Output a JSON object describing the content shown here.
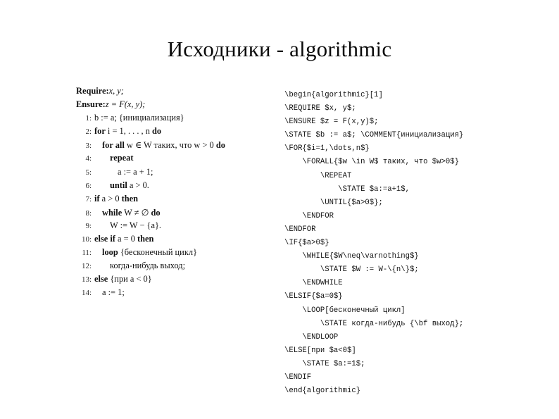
{
  "slide": {
    "title": "Исходники - algorithmic"
  },
  "algorithm_render": {
    "header_lines": [
      {
        "keyword": "Require:",
        "rest": " x, y;"
      },
      {
        "keyword": "Ensure:",
        "rest": " z = F(x, y);"
      }
    ],
    "lines": [
      {
        "num": "1:",
        "indent": 0,
        "text": "b := a;  {инициализация}"
      },
      {
        "num": "2:",
        "indent": 0,
        "text": "for i = 1, . . . , n do"
      },
      {
        "num": "3:",
        "indent": 1,
        "text": "for all w ∈ W таких, что w > 0 do"
      },
      {
        "num": "4:",
        "indent": 2,
        "text": "repeat"
      },
      {
        "num": "5:",
        "indent": 3,
        "text": "a := a + 1;"
      },
      {
        "num": "6:",
        "indent": 2,
        "text": "until a > 0."
      },
      {
        "num": "7:",
        "indent": 0,
        "text": "if a > 0 then"
      },
      {
        "num": "8:",
        "indent": 1,
        "text": "while W ≠ ∅ do"
      },
      {
        "num": "9:",
        "indent": 2,
        "text": "W := W − {a}."
      },
      {
        "num": "10:",
        "indent": 0,
        "text": "else if a = 0 then"
      },
      {
        "num": "11:",
        "indent": 1,
        "text": "loop {бесконечный цикл}"
      },
      {
        "num": "12:",
        "indent": 2,
        "text": "когда-нибудь выход;"
      },
      {
        "num": "13:",
        "indent": 0,
        "text": "else {при a < 0}"
      },
      {
        "num": "14:",
        "indent": 1,
        "text": "a := 1;"
      }
    ]
  },
  "latex_source": {
    "lines": [
      "\\begin{algorithmic}[1]",
      "\\REQUIRE $x, y$;",
      "\\ENSURE $z = F(x,y)$;",
      "\\STATE $b := a$; \\COMMENT{инициализация}",
      "\\FOR{$i=1,\\dots,n$}",
      "    \\FORALL{$w \\in W$ таких, что $w>0$}",
      "        \\REPEAT",
      "            \\STATE $a:=a+1$,",
      "        \\UNTIL{$a>0$};",
      "    \\ENDFOR",
      "\\ENDFOR",
      "\\IF{$a>0$}",
      "    \\WHILE{$W\\neq\\varnothing$}",
      "        \\STATE $W := W-\\{n\\}$;",
      "    \\ENDWHILE",
      "\\ELSIF{$a=0$}",
      "    \\LOOP[бесконечный цикл]",
      "        \\STATE когда-нибудь {\\bf выход};",
      "    \\ENDLOOP",
      "\\ELSE[при $a<0$]",
      "    \\STATE $a:=1$;",
      "\\ENDIF",
      "\\end{algorithmic}"
    ]
  }
}
